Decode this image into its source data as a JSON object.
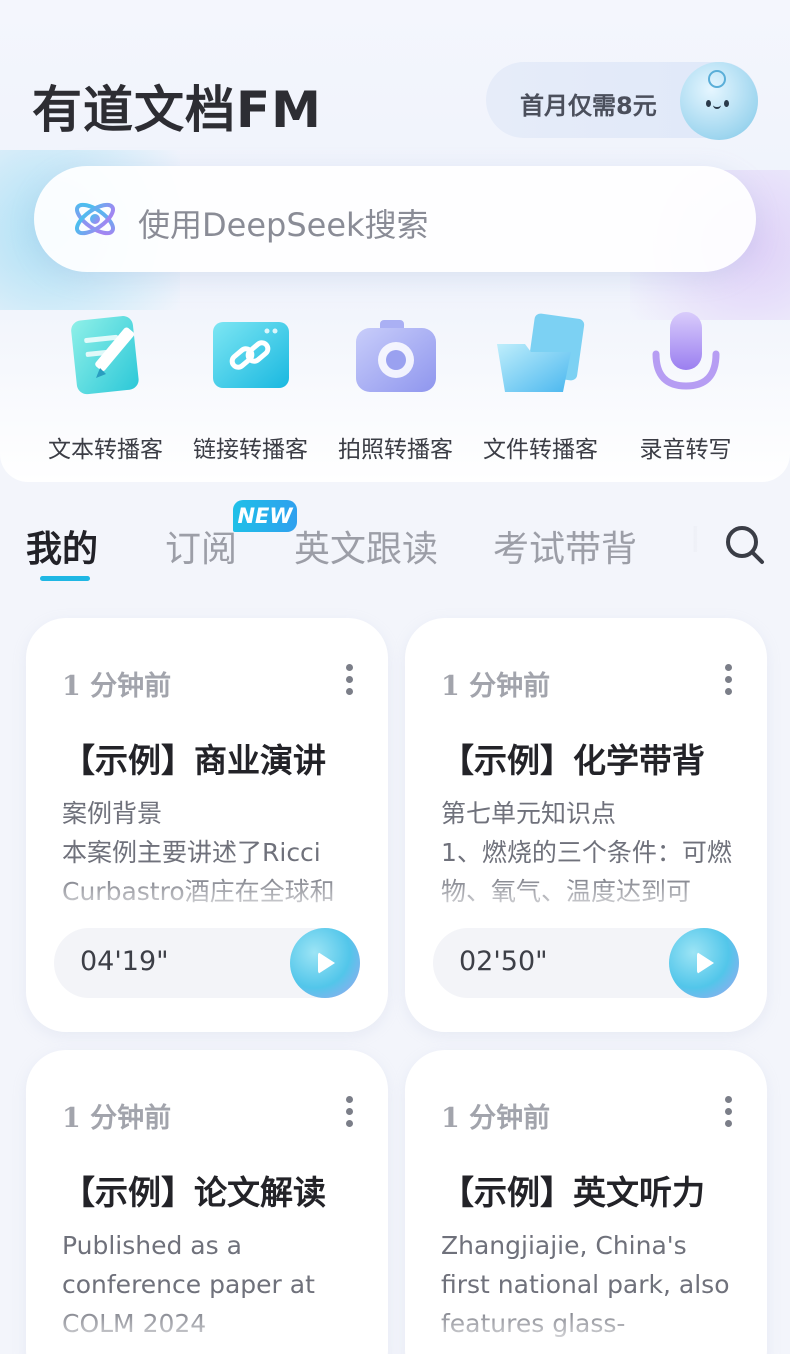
{
  "header": {
    "app_title": "有道文档FM",
    "promo_text": "首月仅需8元"
  },
  "search": {
    "placeholder": "使用DeepSeek搜索"
  },
  "tools": [
    {
      "label": "文本转播客",
      "icon": "text-edit-icon"
    },
    {
      "label": "链接转播客",
      "icon": "link-icon"
    },
    {
      "label": "拍照转播客",
      "icon": "camera-icon"
    },
    {
      "label": "文件转播客",
      "icon": "folder-icon"
    },
    {
      "label": "录音转写",
      "icon": "microphone-icon"
    }
  ],
  "tabs": {
    "items": [
      "我的",
      "订阅",
      "英文跟读",
      "考试带背",
      "I"
    ],
    "active": "我的",
    "new_badge": "NEW"
  },
  "cards": [
    {
      "time": "1 分钟前",
      "title": "【示例】商业演讲",
      "excerpt": "案例背景\n本案例主要讲述了Ricci Curbastro酒庄在全球和",
      "duration": "04'19\""
    },
    {
      "time": "1 分钟前",
      "title": "【示例】化学带背",
      "excerpt": "第七单元知识点\n1、燃烧的三个条件：可燃物、氧气、温度达到可",
      "duration": "02'50\""
    },
    {
      "time": "1 分钟前",
      "title": "【示例】论文解读",
      "excerpt": "Published as a conference paper at COLM 2024",
      "duration": ""
    },
    {
      "time": "1 分钟前",
      "title": "【示例】英文听力",
      "excerpt": "Zhangjiajie, China's first national park, also features glass-",
      "duration": ""
    }
  ],
  "colors": {
    "accent": "#1fb7e4",
    "background": "#f3f5fb",
    "card": "#ffffff",
    "title_text": "#2d2d33"
  }
}
